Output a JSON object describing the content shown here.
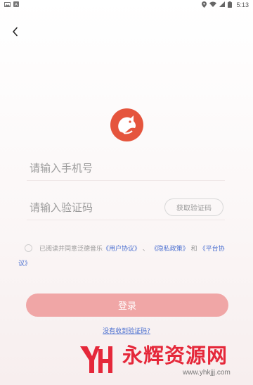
{
  "status_bar": {
    "left_icons": [
      "gallery-icon",
      "notification-a-icon"
    ],
    "right_icons": [
      "location-icon",
      "wifi-icon",
      "signal-icon",
      "battery-icon"
    ],
    "time": "5:13"
  },
  "header": {
    "back_icon": "chevron-left-icon"
  },
  "logo": {
    "icon": "fox-logo-icon",
    "color": "#e5553d"
  },
  "phone": {
    "placeholder": "请输入手机号",
    "value": ""
  },
  "code": {
    "placeholder": "请输入验证码",
    "value": "",
    "get_code_label": "获取验证码"
  },
  "agreement": {
    "checked": false,
    "prefix": "已阅读并同意泛德音乐",
    "link_user": "《用户协议》",
    "sep1": "、",
    "link_privacy": "《隐私政策》",
    "sep2": "和",
    "link_platform": "《平台协议》"
  },
  "login": {
    "label": "登录",
    "color": "#f0a6a6"
  },
  "no_code_label": "没有收到验证码?",
  "watermark": {
    "title": "永辉资源网",
    "url": "www.yhkjjj.com",
    "color": "#e5283a"
  }
}
